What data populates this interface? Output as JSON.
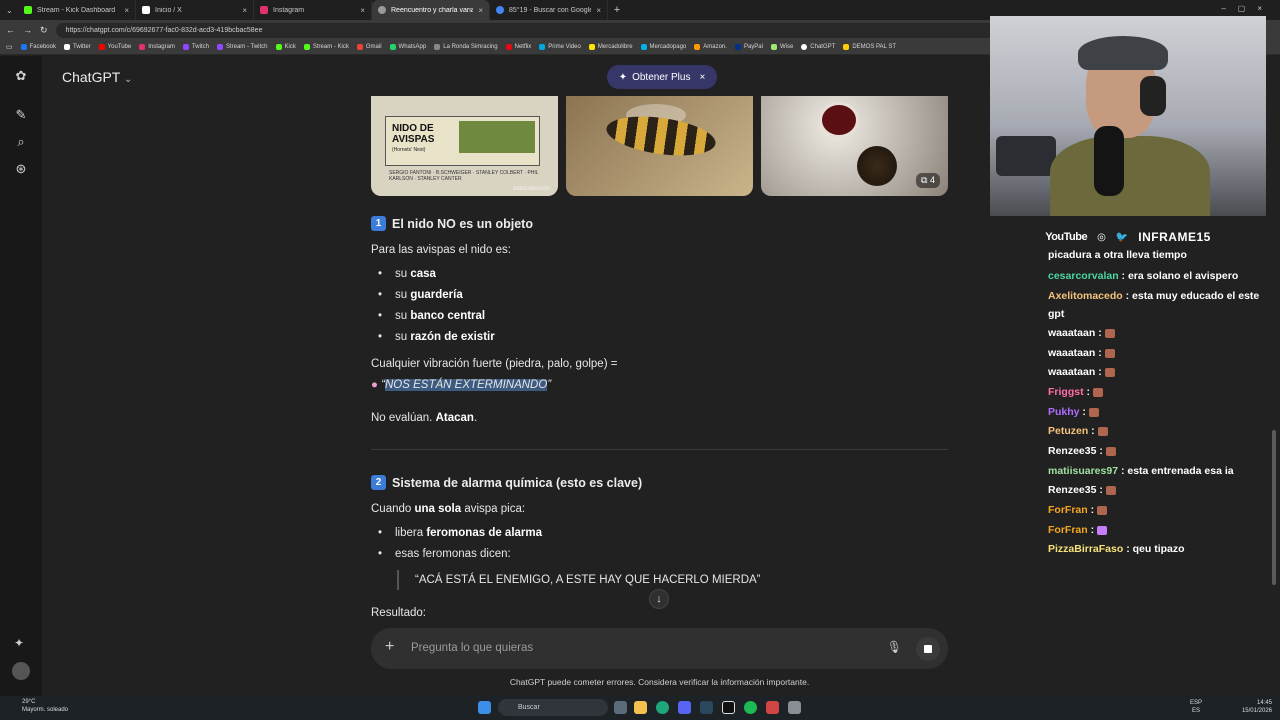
{
  "browser": {
    "tabs": [
      {
        "label": "Stream - Kick Dashboard",
        "color": "#53fc18"
      },
      {
        "label": "Inicio / X",
        "color": "#ffffff"
      },
      {
        "label": "Instagram",
        "color": "#e1306c"
      },
      {
        "label": "Reencuentro y charla variada",
        "color": "#9a9a9a"
      },
      {
        "label": "85°19 - Buscar con Google",
        "color": "#4285f4"
      }
    ],
    "url": "https://chatgpt.com/c/69692677-fac0-832d-acd3-419bcbac58ee",
    "bookmarks": [
      {
        "label": "Facebook",
        "color": "#1877f2"
      },
      {
        "label": "Twitter",
        "color": "#ffffff"
      },
      {
        "label": "YouTube",
        "color": "#ff0000"
      },
      {
        "label": "Instagram",
        "color": "#e1306c"
      },
      {
        "label": "Twitch",
        "color": "#9146ff"
      },
      {
        "label": "Stream - Twitch",
        "color": "#9146ff"
      },
      {
        "label": "Kick",
        "color": "#53fc18"
      },
      {
        "label": "Stream - Kick",
        "color": "#53fc18"
      },
      {
        "label": "Gmail",
        "color": "#ea4335"
      },
      {
        "label": "WhatsApp",
        "color": "#25d366"
      },
      {
        "label": "La Ronda Simracing",
        "color": "#888888"
      },
      {
        "label": "Netflix",
        "color": "#e50914"
      },
      {
        "label": "Prime Video",
        "color": "#00a8e1"
      },
      {
        "label": "Mercadolibre",
        "color": "#ffe600"
      },
      {
        "label": "Mercadopago",
        "color": "#00b1ea"
      },
      {
        "label": "Amazon.",
        "color": "#ff9900"
      },
      {
        "label": "PayPal",
        "color": "#003087"
      },
      {
        "label": "Wise",
        "color": "#9fe870"
      },
      {
        "label": "ChatGPT",
        "color": "#ffffff"
      },
      {
        "label": "DEMOS PAL ST",
        "color": "#ffcc00"
      }
    ]
  },
  "app": {
    "title": "ChatGPT",
    "plus_label": "Obtener Plus"
  },
  "images": {
    "poster_title": "NIDO DE AVISPAS",
    "poster_subtitle": "(Hornets' Nest)",
    "poster_credits": "SERGIO FANTONI · B.SCHWEIGER · STANLEY COLBERT · PHIL KARLSON · STANLEY CANTER",
    "watermark": "todocoleccion",
    "count": "4"
  },
  "section1": {
    "number": "1",
    "title": "El nido NO es un objeto",
    "intro": "Para las avispas el nido es:",
    "items": [
      {
        "pre": "su ",
        "bold": "casa"
      },
      {
        "pre": "su ",
        "bold": "guardería"
      },
      {
        "pre": "su ",
        "bold": "banco central"
      },
      {
        "pre": "su ",
        "bold": "razón de existir"
      }
    ],
    "vibration": "Cualquier vibración fuerte (piedra, palo, golpe) =",
    "quote_open": "“",
    "quote": "NOS ESTÁN EXTERMINANDO",
    "quote_close": "”",
    "conclusion_pre": "No evalúan. ",
    "conclusion_bold": "Atacan",
    "conclusion_post": "."
  },
  "section2": {
    "number": "2",
    "title": "Sistema de alarma química (esto es clave)",
    "intro_pre": "Cuando ",
    "intro_bold": "una sola",
    "intro_post": " avispa pica:",
    "items": [
      {
        "pre": "libera ",
        "bold": "feromonas de alarma"
      },
      {
        "pre": "esas feromonas dicen:",
        "bold": ""
      }
    ],
    "blockquote": "“ACÁ ESTÁ EL ENEMIGO, A ESTE HAY QUE HACERLO MIERDA”",
    "result": "Resultado:"
  },
  "composer": {
    "placeholder": "Pregunta lo que quieras",
    "disclaimer": "ChatGPT puede cometer errores. Considera verificar la información importante."
  },
  "stream": {
    "platform": "YouTube",
    "handle": "INFRAME15",
    "chat": [
      {
        "user": "",
        "text": "picadura a otra lleva tiempo",
        "color": "#ffffff"
      },
      {
        "user": "cesarcorvalan",
        "text": " : era solano el avispero",
        "color": "#4ad6a0"
      },
      {
        "user": "Axelitomacedo",
        "text": " : esta muy educado el este gpt",
        "color": "#f5c27a"
      },
      {
        "user": "waaataan",
        "text": " : ",
        "color": "#ffffff",
        "emote": true
      },
      {
        "user": "waaataan",
        "text": " : ",
        "color": "#ffffff",
        "emote": true
      },
      {
        "user": "waaataan",
        "text": " : ",
        "color": "#ffffff",
        "emote": true
      },
      {
        "user": "Friggst",
        "text": " : ",
        "color": "#ff6fa8",
        "emote": true
      },
      {
        "user": "Pukhy",
        "text": " : ",
        "color": "#b06cff",
        "emote": true
      },
      {
        "user": "Petuzen",
        "text": " : ",
        "color": "#f5c27a",
        "emote": true
      },
      {
        "user": "Renzee35",
        "text": " : ",
        "color": "#ffffff",
        "emote": true
      },
      {
        "user": "matiisuares97",
        "text": " : esta entrenada esa ia",
        "color": "#9fe0a0"
      },
      {
        "user": "Renzee35",
        "text": " : ",
        "color": "#ffffff",
        "emote": true
      },
      {
        "user": "ForFran",
        "text": " : ",
        "color": "#f5a623",
        "emote": true
      },
      {
        "user": "ForFran",
        "text": " : ",
        "color": "#f5a623",
        "emote": true
      },
      {
        "user": "PizzaBirraFaso",
        "text": " : qeu tipazo",
        "color": "#f5e27a"
      }
    ]
  },
  "taskbar": {
    "temp": "29°C",
    "weather": "Mayorm. soleado",
    "search": "Buscar",
    "lang": "ESP",
    "lang2": "ES",
    "time": "14:45",
    "date": "15/01/2026"
  }
}
